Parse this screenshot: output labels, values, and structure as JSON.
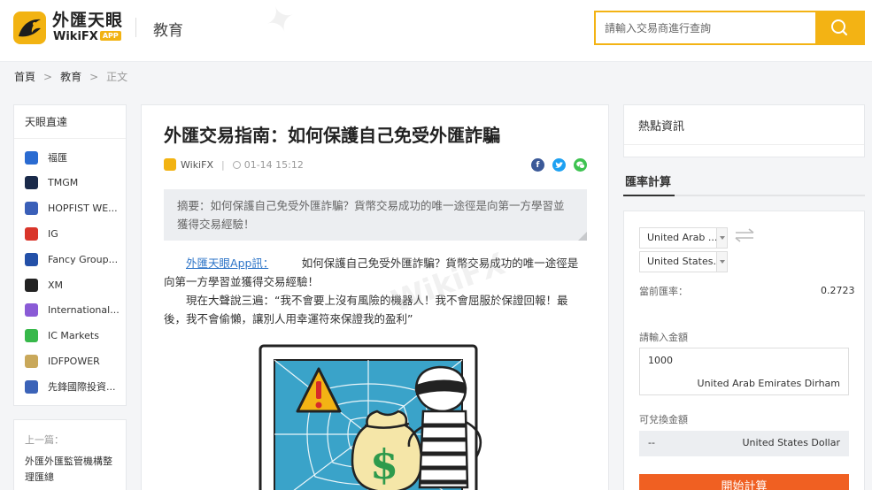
{
  "header": {
    "logo_cn": "外匯天眼",
    "logo_en": "WikiFX",
    "logo_badge": "APP",
    "section": "教育",
    "search_placeholder": "請輸入交易商進行查詢"
  },
  "breadcrumb": {
    "home": "首頁",
    "sep": ">",
    "category": "教育",
    "current": "正文"
  },
  "sidebar": {
    "title": "天眼直達",
    "brokers": [
      {
        "name": "福匯",
        "color": "#2a6bd1"
      },
      {
        "name": "TMGM",
        "color": "#1a2a4a"
      },
      {
        "name": "HOPFIST WE...",
        "color": "#3a5fb8"
      },
      {
        "name": "IG",
        "color": "#d9352a"
      },
      {
        "name": "Fancy Group...",
        "color": "#2350a8"
      },
      {
        "name": "XM",
        "color": "#222222"
      },
      {
        "name": "International...",
        "color": "#8a5bd6"
      },
      {
        "name": "IC Markets",
        "color": "#37b84a"
      },
      {
        "name": "IDFPOWER",
        "color": "#c9a85a"
      },
      {
        "name": "先鋒國際投資...",
        "color": "#3b63b8"
      }
    ],
    "prev_label": "上一篇：",
    "prev_title": "外匯外匯監管機構整理匯總"
  },
  "article": {
    "title": "外匯交易指南：如何保護自己免受外匯詐騙",
    "author": "WikiFX",
    "sep": "|",
    "time": "01-14 15:12",
    "summary": "摘要：如何保護自己免受外匯詐騙？貨幣交易成功的唯一途徑是向第一方學習並獲得交易經驗！",
    "link_text": "外匯天眼App訊：",
    "para1_rest": "如何保護自己免受外匯詐騙？貨幣交易成功的唯一途徑是向第一方學習並獲得交易經驗！",
    "para2": "現在大聲說三遍：“我不會要上沒有風險的機器人！我不會屈服於保證回報！最後，我不會偷懶，讓別人用幸運符來保證我的盈利”"
  },
  "right": {
    "hot_title": "熱點資訊",
    "rate_title": "匯率計算",
    "from_currency": "United Arab ...",
    "to_currency": "United States...",
    "current_rate_label": "當前匯率：",
    "current_rate_value": "0.2723",
    "amount_label": "請輸入金額",
    "amount_value": "1000",
    "amount_currency": "United Arab Emirates Dirham",
    "convertible_label": "可兌換金額",
    "convertible_value": "--",
    "convertible_currency": "United States Dollar",
    "calc_button": "開始計算"
  },
  "colors": {
    "brand_yellow": "#f3b314",
    "link_blue": "#2e75c8",
    "calc_orange": "#f06022"
  }
}
